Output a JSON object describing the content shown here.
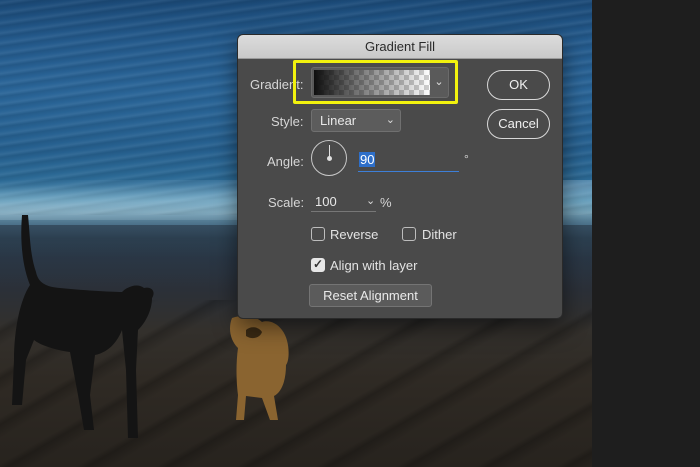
{
  "dialog": {
    "title": "Gradient Fill",
    "gradient": {
      "label": "Gradient:",
      "dropdown_icon": "chevron-down-icon"
    },
    "style": {
      "label": "Style:",
      "value": "Linear"
    },
    "angle": {
      "label": "Angle:",
      "value": "90",
      "unit": "°"
    },
    "scale": {
      "label": "Scale:",
      "value": "100",
      "unit": "%"
    },
    "reverse": {
      "label": "Reverse",
      "checked": false
    },
    "dither": {
      "label": "Dither",
      "checked": false
    },
    "align_with_layer": {
      "label": "Align with layer",
      "checked": true
    },
    "reset_alignment_label": "Reset Alignment",
    "ok_label": "OK",
    "cancel_label": "Cancel"
  },
  "colors": {
    "highlight": "#f2f20e",
    "selection": "#2e6fc9",
    "dialog_bg": "#4a4a4a"
  }
}
